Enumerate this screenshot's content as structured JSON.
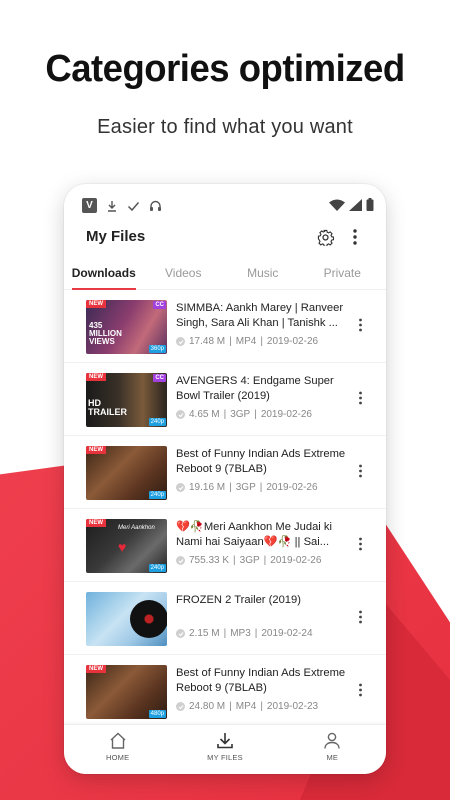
{
  "promo": {
    "headline": "Categories optimized",
    "subhead": "Easier to find what you want",
    "accent_color": "#e6303f"
  },
  "statusbar": {
    "app_badge": "V",
    "left_icons": [
      "download-icon",
      "check-icon",
      "headphones-icon"
    ],
    "right_icons": [
      "wifi-icon",
      "signal-icon",
      "battery-icon"
    ]
  },
  "header": {
    "title": "My Files",
    "icons": [
      "gear-icon",
      "more-vert-icon"
    ]
  },
  "tabs": [
    {
      "label": "Downloads",
      "active": true
    },
    {
      "label": "Videos",
      "active": false
    },
    {
      "label": "Music",
      "active": false
    },
    {
      "label": "Private",
      "active": false
    }
  ],
  "files": [
    {
      "title": "SIMMBA: Aankh Marey | Ranveer Singh, Sara Ali Khan | Tanishk ...",
      "size": "17.48 M",
      "format": "MP4",
      "date": "2019-02-26",
      "badge_new": "NEW",
      "badge_cc": "CC",
      "resolution": "360p",
      "thumb_text": "435 MILLION VIEWS"
    },
    {
      "title": "AVENGERS 4: Endgame Super Bowl Trailer (2019)",
      "size": "4.65 M",
      "format": "3GP",
      "date": "2019-02-26",
      "badge_new": "NEW",
      "badge_cc": "CC",
      "resolution": "240p",
      "thumb_text": "HD TRAILER"
    },
    {
      "title": "Best of Funny Indian Ads Extreme Reboot 9 (7BLAB)",
      "size": "19.16 M",
      "format": "3GP",
      "date": "2019-02-26",
      "badge_new": "NEW",
      "badge_cc": "",
      "resolution": "240p",
      "thumb_text": ""
    },
    {
      "title": "💔🥀Meri Aankhon Me Judai ki Nami hai Saiyaan💔🥀 || Sai...",
      "size": "755.33 K",
      "format": "3GP",
      "date": "2019-02-26",
      "badge_new": "NEW",
      "badge_cc": "",
      "resolution": "240p",
      "thumb_text": "Meri Aankhon"
    },
    {
      "title": "FROZEN 2 Trailer (2019)",
      "size": "2.15 M",
      "format": "MP3",
      "date": "2019-02-24",
      "badge_new": "",
      "badge_cc": "",
      "resolution": "",
      "thumb_text": ""
    },
    {
      "title": "Best of Funny Indian Ads Extreme Reboot 9 (7BLAB)",
      "size": "24.80 M",
      "format": "MP4",
      "date": "2019-02-23",
      "badge_new": "NEW",
      "badge_cc": "",
      "resolution": "480p",
      "thumb_text": ""
    }
  ],
  "bottom_nav": [
    {
      "label": "HOME",
      "icon": "home-icon"
    },
    {
      "label": "MY FILES",
      "icon": "download-icon"
    },
    {
      "label": "ME",
      "icon": "user-icon"
    }
  ]
}
